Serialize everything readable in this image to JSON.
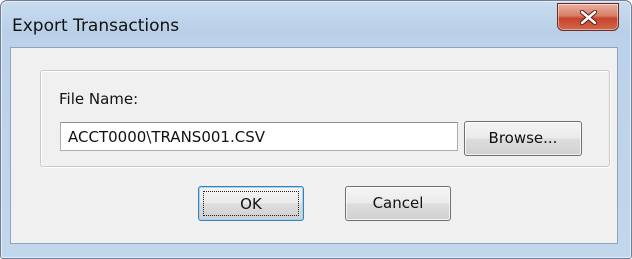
{
  "window": {
    "title": "Export Transactions"
  },
  "icons": {
    "close": "close-icon"
  },
  "form": {
    "file_name_label": "File Name:",
    "file_name_value": "ACCT0000\\TRANS001.CSV",
    "browse_label": "Browse..."
  },
  "buttons": {
    "ok_label": "OK",
    "cancel_label": "Cancel"
  },
  "colors": {
    "title_bar": "#bcd2ea",
    "client_background": "#f0f0f0",
    "close_button": "#c6452c",
    "default_button_border": "#3c7fb1"
  }
}
